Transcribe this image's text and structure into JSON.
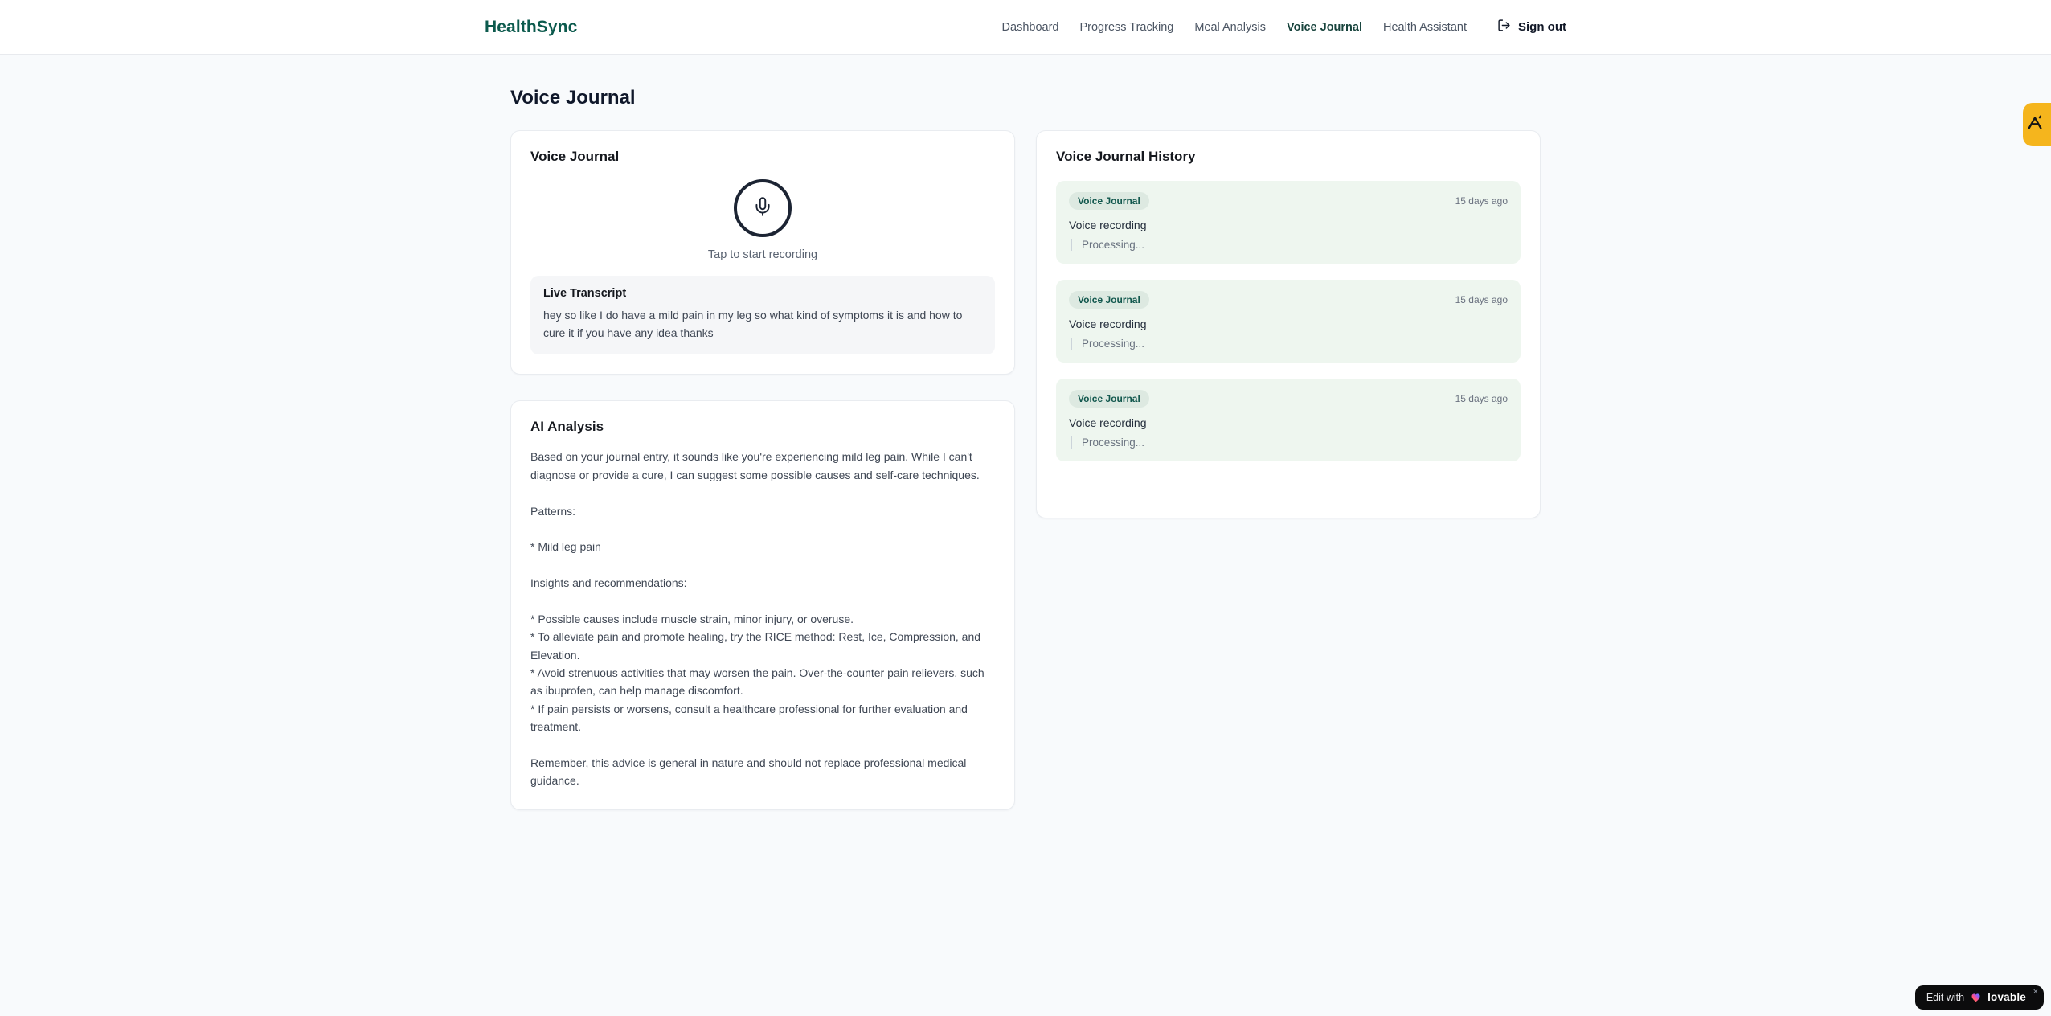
{
  "brand": {
    "name": "HealthSync",
    "color": "#0c5a4d"
  },
  "nav": {
    "items": [
      {
        "label": "Dashboard",
        "active": false
      },
      {
        "label": "Progress Tracking",
        "active": false
      },
      {
        "label": "Meal Analysis",
        "active": false
      },
      {
        "label": "Voice Journal",
        "active": true
      },
      {
        "label": "Health Assistant",
        "active": false
      }
    ],
    "signout_label": "Sign out"
  },
  "page": {
    "title": "Voice Journal"
  },
  "recorder": {
    "card_title": "Voice Journal",
    "tap_label": "Tap to start recording",
    "transcript_title": "Live Transcript",
    "transcript_text": "hey so like I do have a mild pain in my leg so what kind of symptoms it is and how to cure it if you have any idea thanks"
  },
  "analysis": {
    "card_title": "AI Analysis",
    "body": "Based on your journal entry, it sounds like you're experiencing mild leg pain. While I can't diagnose or provide a cure, I can suggest some possible causes and self-care techniques.\n\nPatterns:\n\n* Mild leg pain\n\nInsights and recommendations:\n\n* Possible causes include muscle strain, minor injury, or overuse.\n* To alleviate pain and promote healing, try the RICE method: Rest, Ice, Compression, and Elevation.\n* Avoid strenuous activities that may worsen the pain. Over-the-counter pain relievers, such as ibuprofen, can help manage discomfort.\n* If pain persists or worsens, consult a healthcare professional for further evaluation and treatment.\n\nRemember, this advice is general in nature and should not replace professional medical guidance."
  },
  "history": {
    "card_title": "Voice Journal History",
    "entries": [
      {
        "badge": "Voice Journal",
        "time": "15 days ago",
        "title": "Voice recording",
        "status": "Processing..."
      },
      {
        "badge": "Voice Journal",
        "time": "15 days ago",
        "title": "Voice recording",
        "status": "Processing..."
      },
      {
        "badge": "Voice Journal",
        "time": "15 days ago",
        "title": "Voice recording",
        "status": "Processing..."
      }
    ]
  },
  "floating": {
    "edit_badge": {
      "prefix": "Edit with",
      "brand": "lovable",
      "close": "×"
    },
    "side_badge_color": "#f5b51d"
  },
  "colors": {
    "accent_teal": "#0c5a4d",
    "active_nav": "#17433c",
    "entry_bg": "#eef6ef",
    "badge_bg": "#dde9e1",
    "badge_text": "#11574d",
    "mic_ring": "#1c2433",
    "page_bg": "#f8fafc"
  }
}
